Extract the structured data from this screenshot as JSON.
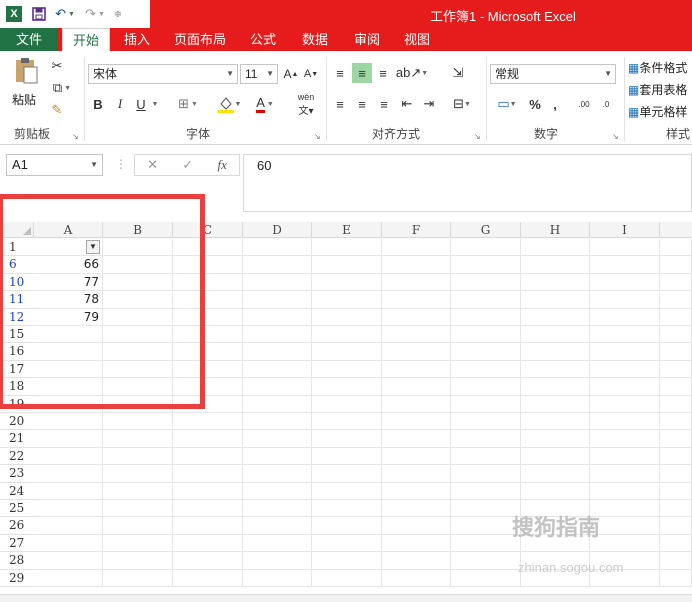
{
  "app": {
    "window_title": "工作簿1 - Microsoft Excel",
    "logo_letter": "X"
  },
  "qat": {
    "save_icon": "save-icon",
    "undo_icon": "undo-icon",
    "redo_icon": "redo-icon",
    "customize_icon": "customize-qat-icon"
  },
  "tabs": [
    {
      "label": "文件"
    },
    {
      "label": "开始"
    },
    {
      "label": "插入"
    },
    {
      "label": "页面布局"
    },
    {
      "label": "公式"
    },
    {
      "label": "数据"
    },
    {
      "label": "审阅"
    },
    {
      "label": "视图"
    }
  ],
  "ribbon": {
    "clipboard": {
      "paste_label": "粘贴",
      "group_label": "剪贴板"
    },
    "font": {
      "name": "宋体",
      "size": "11",
      "bold": "B",
      "italic": "I",
      "underline": "U",
      "grow": "A",
      "shrink": "A",
      "wen": "wén",
      "font_color_letter": "A",
      "group_label": "字体"
    },
    "alignment": {
      "group_label": "对齐方式"
    },
    "number": {
      "format": "常规",
      "percent": "%",
      "comma": ",",
      "inc_dec": ".00",
      "dec_dec": ".0",
      "group_label": "数字"
    },
    "styles": {
      "conditional": "条件格式",
      "table": "套用表格",
      "cell": "单元格样",
      "group_label": "样式"
    }
  },
  "formula_bar": {
    "name_box": "A1",
    "cancel": "✕",
    "enter": "✓",
    "fx": "fx",
    "value": "60"
  },
  "columns": [
    "A",
    "B",
    "C",
    "D",
    "E",
    "F",
    "G",
    "H",
    "I"
  ],
  "rows": [
    {
      "num": "1",
      "a": "",
      "filtered": false
    },
    {
      "num": "6",
      "a": "66",
      "filtered": true
    },
    {
      "num": "10",
      "a": "77",
      "filtered": true
    },
    {
      "num": "11",
      "a": "78",
      "filtered": true
    },
    {
      "num": "12",
      "a": "79",
      "filtered": true
    },
    {
      "num": "15",
      "a": "",
      "filtered": false
    },
    {
      "num": "16",
      "a": "",
      "filtered": false
    },
    {
      "num": "17",
      "a": "",
      "filtered": false
    },
    {
      "num": "18",
      "a": "",
      "filtered": false
    },
    {
      "num": "19",
      "a": "",
      "filtered": false
    },
    {
      "num": "20",
      "a": "",
      "filtered": false
    },
    {
      "num": "21",
      "a": "",
      "filtered": false
    },
    {
      "num": "22",
      "a": "",
      "filtered": false
    },
    {
      "num": "23",
      "a": "",
      "filtered": false
    },
    {
      "num": "24",
      "a": "",
      "filtered": false
    },
    {
      "num": "25",
      "a": "",
      "filtered": false
    },
    {
      "num": "26",
      "a": "",
      "filtered": false
    },
    {
      "num": "27",
      "a": "",
      "filtered": false
    },
    {
      "num": "28",
      "a": "",
      "filtered": false
    },
    {
      "num": "29",
      "a": "",
      "filtered": false
    }
  ],
  "watermark": {
    "text": "搜狗指南",
    "sub": "zhinan.sogou.com"
  },
  "colors": {
    "title_red": "#e61c1c",
    "excel_green": "#217346",
    "highlight_box": "#ea3f3f",
    "filtered_row": "#1e40c8"
  }
}
